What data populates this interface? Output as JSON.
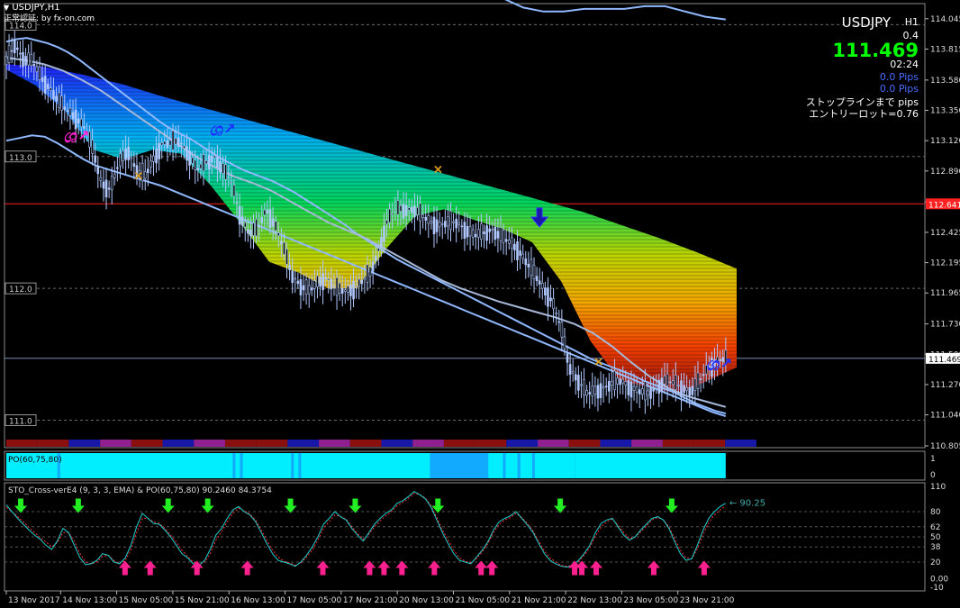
{
  "window": {
    "title": "USDJPY,H1",
    "caption": "正常認証: by fx-on.com"
  },
  "info_panel": {
    "symbol": "USDJPY",
    "timeframe": "H1",
    "spread": "0.4",
    "price": "111.469",
    "timer": "02:24",
    "pips1": "0.0 Pips",
    "pips2": "0.0 Pips",
    "stopline": "ストップラインまで pips",
    "entry_lot": "エントリーロット=0.76"
  },
  "colors": {
    "background": "#000000",
    "price_green": "#00ff00",
    "pips_blue": "#4a6cff",
    "band_line": "#8fb8ff",
    "red_level": "#ff2020",
    "po_cyan": "#00eeff",
    "po_blue": "#12aaff",
    "arrow_up": "#ff2090",
    "arrow_down": "#22ee22",
    "stoch_main": "#20d0d0",
    "stoch_signal": "#ff3030"
  },
  "chart_data": [
    {
      "type": "candlestick",
      "symbol": "USDJPY",
      "timeframe": "H1",
      "y_axis_ticks": [
        "114.045",
        "113.815",
        "113.580",
        "113.350",
        "113.120",
        "112.890",
        "112.655",
        "112.425",
        "112.195",
        "111.965",
        "111.730",
        "111.500",
        "111.270",
        "111.040",
        "110.805"
      ],
      "y_range": [
        110.805,
        114.16
      ],
      "grid_levels": [
        "114.0",
        "113.0",
        "112.0",
        "111.0"
      ],
      "red_level": "112.641",
      "current_price_label": "111.469",
      "x_axis_labels": [
        "13 Nov 2017",
        "14 Nov 13:00",
        "15 Nov 05:00",
        "15 Nov 21:00",
        "16 Nov 13:00",
        "17 Nov 05:00",
        "17 Nov 21:00",
        "20 Nov 13:00",
        "21 Nov 05:00",
        "21 Nov 21:00",
        "22 Nov 13:00",
        "23 Nov 05:00",
        "23 Nov 21:00"
      ],
      "close_path": [
        113.72,
        113.85,
        113.74,
        113.72,
        113.6,
        113.52,
        113.42,
        113.35,
        113.3,
        113.22,
        113.05,
        112.8,
        112.75,
        112.95,
        113.05,
        112.9,
        112.85,
        112.98,
        113.1,
        113.1,
        113.12,
        113.02,
        112.9,
        112.95,
        113.0,
        112.9,
        112.8,
        112.55,
        112.42,
        112.45,
        112.6,
        112.48,
        112.3,
        112.1,
        112.02,
        111.98,
        112.05,
        112.08,
        112.0,
        111.98,
        112.0,
        112.05,
        112.12,
        112.3,
        112.52,
        112.6,
        112.6,
        112.6,
        112.55,
        112.5,
        112.48,
        112.5,
        112.5,
        112.45,
        112.4,
        112.42,
        112.45,
        112.4,
        112.35,
        112.3,
        112.2,
        112.1,
        112.0,
        111.9,
        111.7,
        111.4,
        111.3,
        111.2,
        111.22,
        111.25,
        111.28,
        111.3,
        111.25,
        111.22,
        111.2,
        111.25,
        111.3,
        111.28,
        111.25,
        111.22,
        111.3,
        111.4,
        111.45,
        111.47
      ],
      "mid_band": [
        113.75,
        113.73,
        113.7,
        113.65,
        113.58,
        113.5,
        113.4,
        113.3,
        113.2,
        113.1,
        113.0,
        112.92,
        112.85,
        112.8,
        112.74,
        112.66,
        112.58,
        112.5,
        112.44,
        112.38,
        112.3,
        112.22,
        112.14,
        112.06,
        112.0,
        111.95,
        111.9,
        111.86,
        111.82,
        111.78,
        111.73,
        111.66,
        111.56,
        111.44,
        111.33,
        111.24,
        111.18,
        111.14,
        111.1
      ],
      "upper_band": [
        113.87,
        113.89,
        113.9,
        113.88,
        113.86,
        113.83,
        113.79,
        113.74,
        113.68,
        113.62,
        113.56,
        113.5,
        113.44,
        113.38,
        113.32,
        113.26,
        113.21,
        113.17,
        113.13,
        113.08,
        113.03,
        112.98,
        112.94,
        112.9,
        112.87,
        112.84,
        112.81,
        112.77,
        112.73,
        112.68,
        112.63,
        112.58,
        112.53,
        112.48,
        112.42,
        112.37,
        112.32,
        112.27,
        112.22,
        112.18,
        112.14,
        112.1,
        112.06,
        112.02,
        111.98,
        111.94,
        111.9,
        111.86,
        111.82,
        111.78,
        111.74,
        111.7,
        111.66,
        111.62,
        111.58,
        111.54,
        111.5,
        111.46,
        111.43,
        111.4,
        111.37,
        111.34,
        111.3,
        111.27,
        111.24,
        111.21,
        111.17,
        111.13,
        111.1,
        111.07,
        111.05
      ],
      "lower_band": [
        113.12,
        113.14,
        113.16,
        113.15,
        113.1,
        113.04,
        112.98,
        112.93,
        112.9,
        112.87,
        112.84,
        112.81,
        112.78,
        112.74,
        112.7,
        112.66,
        112.62,
        112.58,
        112.54,
        112.5,
        112.46,
        112.42,
        112.38,
        112.34,
        112.3,
        112.26,
        112.22,
        112.18,
        112.14,
        112.1,
        112.06,
        112.02,
        111.98,
        111.94,
        111.9,
        111.86,
        111.82,
        111.78,
        111.74,
        111.7,
        111.66,
        111.62,
        111.58,
        111.54,
        111.5,
        111.46,
        111.42,
        111.38,
        111.34,
        111.3,
        111.26,
        111.22,
        111.18,
        111.14,
        111.1,
        111.06,
        111.03
      ],
      "top_band_partial": [
        114.2,
        114.13,
        114.1,
        114.1,
        114.12,
        114.12,
        114.12,
        114.14,
        114.14,
        114.1,
        114.06,
        114.04
      ],
      "ribbon_top": [
        113.7,
        113.68,
        113.62,
        113.55,
        113.46,
        113.38,
        113.3,
        113.22,
        113.14,
        113.06,
        112.98,
        112.9,
        112.82,
        112.74,
        112.66,
        112.58,
        112.48,
        112.38,
        112.27,
        112.15
      ],
      "ribbon_bottom": [
        113.66,
        113.54,
        113.35,
        113.05,
        112.98,
        113.05,
        113.02,
        112.78,
        112.5,
        112.2,
        112.12,
        112.0,
        112.0,
        112.3,
        112.55,
        112.6,
        112.52,
        112.45,
        112.35,
        112.05,
        111.6,
        111.3,
        111.25,
        111.2,
        111.3,
        111.4
      ],
      "markers": [
        {
          "type": "cross",
          "price": 112.85
        },
        {
          "type": "cross",
          "price": 112.9
        },
        {
          "type": "cross",
          "price": 111.44
        },
        {
          "type": "down-arrow",
          "price": 112.5
        },
        {
          "type": "sign-magenta",
          "price": 113.15
        },
        {
          "type": "sign-blue",
          "price": 113.2
        },
        {
          "type": "sign-blue",
          "price": 111.42
        }
      ]
    },
    {
      "type": "bar",
      "title": "PO(60,75,80)",
      "y_ticks": [
        "1",
        "0"
      ],
      "segments": [
        {
          "from": 0,
          "to": 0.63,
          "value": "cyan"
        },
        {
          "from": 0.63,
          "to": 0.66,
          "value": "blue"
        },
        {
          "from": 0.66,
          "to": 0.79,
          "value": "cyan"
        },
        {
          "from": 0.79,
          "to": 1,
          "value": "mixed"
        }
      ]
    },
    {
      "type": "line",
      "title": "STO_Cross-verE4 (9, 3, 3, EMA) & PO(60,75,80) 90.2460 84.3754",
      "y_ticks": [
        "110",
        "80",
        "62",
        "50",
        "38",
        "20",
        "0.00",
        "-10"
      ],
      "y_range": [
        -10,
        110
      ],
      "last_value_label": "90.25",
      "main": [
        88,
        80,
        72,
        65,
        58,
        52,
        47,
        40,
        35,
        45,
        60,
        55,
        40,
        25,
        17,
        18,
        22,
        30,
        28,
        20,
        18,
        25,
        40,
        62,
        78,
        72,
        66,
        65,
        58,
        50,
        40,
        30,
        25,
        18,
        16,
        22,
        35,
        52,
        60,
        72,
        82,
        86,
        80,
        76,
        68,
        55,
        42,
        30,
        22,
        20,
        18,
        15,
        20,
        28,
        38,
        50,
        65,
        72,
        80,
        74,
        70,
        60,
        52,
        45,
        55,
        65,
        72,
        78,
        82,
        90,
        93,
        98,
        104,
        100,
        95,
        85,
        70,
        55,
        42,
        30,
        22,
        20,
        18,
        26,
        34,
        44,
        58,
        68,
        72,
        75,
        80,
        72,
        64,
        55,
        42,
        30,
        22,
        18,
        15,
        14,
        16,
        22,
        30,
        40,
        55,
        66,
        70,
        72,
        62,
        52,
        46,
        50,
        58,
        65,
        72,
        74,
        70,
        60,
        44,
        30,
        22,
        24,
        40,
        58,
        72,
        80,
        86,
        90
      ],
      "signal": [
        85,
        80,
        74,
        68,
        61,
        55,
        49,
        44,
        38,
        43,
        55,
        55,
        45,
        30,
        20,
        18,
        20,
        27,
        28,
        22,
        18,
        22,
        35,
        55,
        72,
        72,
        68,
        66,
        60,
        52,
        44,
        34,
        27,
        20,
        17,
        20,
        30,
        46,
        56,
        68,
        78,
        84,
        81,
        77,
        70,
        58,
        46,
        34,
        26,
        21,
        19,
        16,
        19,
        26,
        34,
        46,
        60,
        68,
        76,
        74,
        71,
        62,
        54,
        47,
        53,
        62,
        69,
        75,
        80,
        87,
        91,
        96,
        102,
        100,
        96,
        87,
        73,
        58,
        46,
        34,
        25,
        21,
        19,
        24,
        32,
        42,
        55,
        65,
        70,
        73,
        78,
        73,
        66,
        57,
        45,
        33,
        25,
        20,
        16,
        15,
        16,
        20,
        28,
        37,
        51,
        62,
        68,
        71,
        64,
        55,
        48,
        50,
        56,
        63,
        70,
        73,
        70,
        62,
        48,
        34,
        25,
        24,
        36,
        53,
        67,
        76,
        82,
        87
      ],
      "buy_arrows": [
        0.165,
        0.2,
        0.265,
        0.335,
        0.44,
        0.505,
        0.525,
        0.55,
        0.595,
        0.66,
        0.675,
        0.79,
        0.8,
        0.82,
        0.9,
        0.97
      ],
      "sell_arrows": [
        0.02,
        0.1,
        0.225,
        0.28,
        0.395,
        0.485,
        0.6,
        0.77,
        0.925
      ]
    }
  ]
}
